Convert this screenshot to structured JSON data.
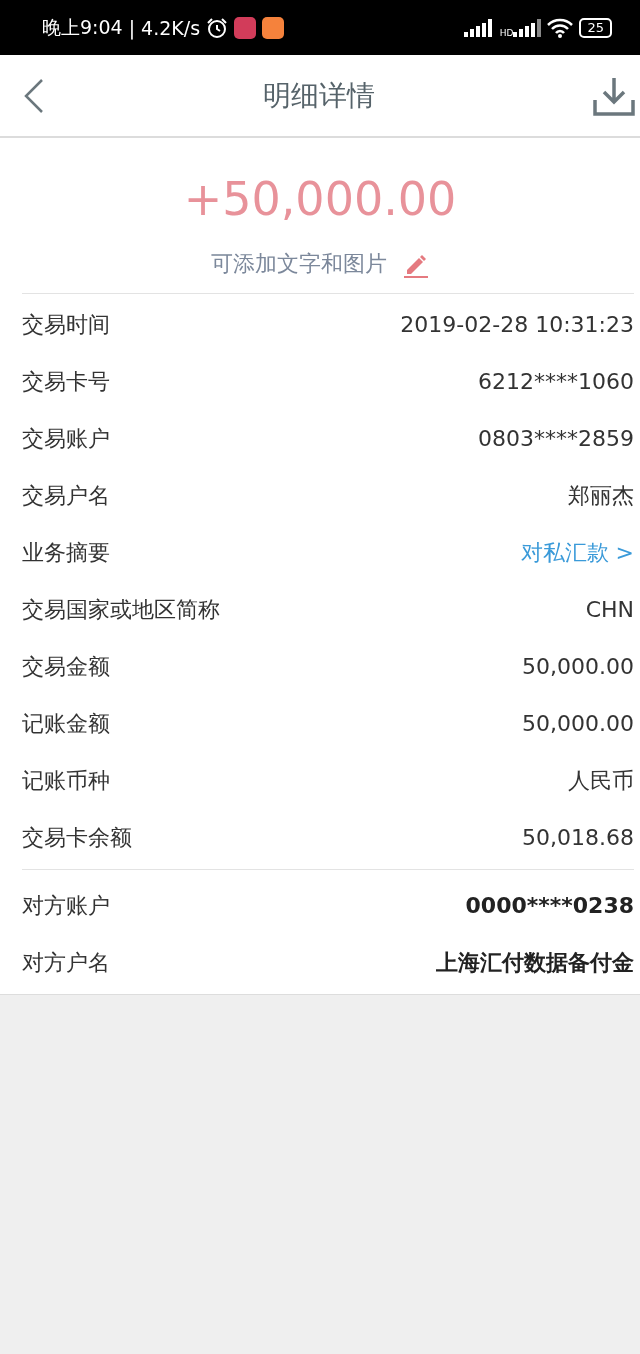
{
  "status_bar": {
    "time": "晚上9:04",
    "speed": "| 4.2K/s",
    "network": "HD",
    "battery": "25"
  },
  "header": {
    "title": "明细详情"
  },
  "amount": "+50,000.00",
  "note": "可添加文字和图片",
  "sections": [
    {
      "rows": [
        {
          "label": "交易时间",
          "value": "2019-02-28 10:31:23",
          "kind": "plain"
        },
        {
          "label": "交易卡号",
          "value": "6212****1060",
          "kind": "plain"
        },
        {
          "label": "交易账户",
          "value": "0803****2859",
          "kind": "plain"
        },
        {
          "label": "交易户名",
          "value": "郑丽杰",
          "kind": "plain"
        },
        {
          "label": "业务摘要",
          "value": "对私汇款 >",
          "kind": "link"
        },
        {
          "label": "交易国家或地区简称",
          "value": "CHN",
          "kind": "plain"
        },
        {
          "label": "交易金额",
          "value": "50,000.00",
          "kind": "plain"
        },
        {
          "label": "记账金额",
          "value": "50,000.00",
          "kind": "plain"
        },
        {
          "label": "记账币种",
          "value": "人民币",
          "kind": "plain"
        },
        {
          "label": "交易卡余额",
          "value": "50,018.68",
          "kind": "plain"
        }
      ]
    },
    {
      "rows": [
        {
          "label": "对方账户",
          "value": "0000****0238",
          "kind": "bold"
        },
        {
          "label": "对方户名",
          "value": "上海汇付数据备付金",
          "kind": "bold"
        }
      ]
    }
  ]
}
